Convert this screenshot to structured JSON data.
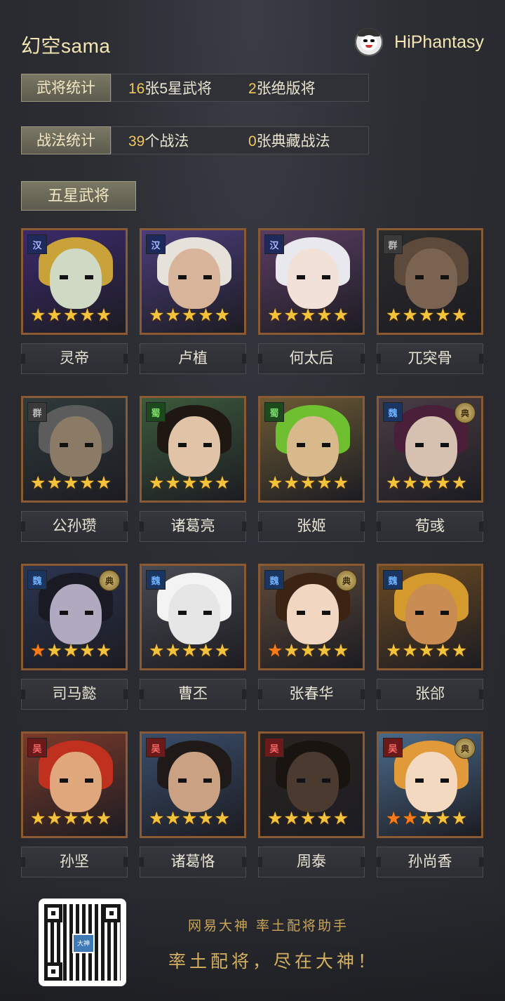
{
  "header": {
    "player_name": "幻空sama",
    "brand_name": "HiPhantasy",
    "brand_icon": "mascot-avatar-icon"
  },
  "hero_stats": {
    "tag": "武将统计",
    "five_star_count": "16",
    "five_star_suffix": "张5星武将",
    "limited_count": "2",
    "limited_suffix": "张绝版将"
  },
  "skill_stats": {
    "tag": "战法统计",
    "skill_count": "39",
    "skill_suffix": "个战法",
    "collection_count": "0",
    "collection_suffix": "张典藏战法"
  },
  "section_title": "五星武将",
  "colors": {
    "accent_gold": "#f0c85a",
    "star_yellow": "#f5c33b",
    "star_orange": "#ff7a1a",
    "frame_bronze": "#8b5a32"
  },
  "heroes": [
    {
      "name": "灵帝",
      "faction": "汉",
      "limited": false,
      "orange_stars": 0
    },
    {
      "name": "卢植",
      "faction": "汉",
      "limited": false,
      "orange_stars": 0
    },
    {
      "name": "何太后",
      "faction": "汉",
      "limited": false,
      "orange_stars": 0
    },
    {
      "name": "兀突骨",
      "faction": "群",
      "limited": false,
      "orange_stars": 0
    },
    {
      "name": "公孙瓒",
      "faction": "群",
      "limited": false,
      "orange_stars": 0
    },
    {
      "name": "诸葛亮",
      "faction": "蜀",
      "limited": false,
      "orange_stars": 0
    },
    {
      "name": "张姬",
      "faction": "蜀",
      "limited": false,
      "orange_stars": 0
    },
    {
      "name": "荀彧",
      "faction": "魏",
      "limited": true,
      "orange_stars": 0
    },
    {
      "name": "司马懿",
      "faction": "魏",
      "limited": true,
      "orange_stars": 1
    },
    {
      "name": "曹丕",
      "faction": "魏",
      "limited": false,
      "orange_stars": 0
    },
    {
      "name": "张春华",
      "faction": "魏",
      "limited": true,
      "orange_stars": 1
    },
    {
      "name": "张郃",
      "faction": "魏",
      "limited": false,
      "orange_stars": 0
    },
    {
      "name": "孙坚",
      "faction": "吴",
      "limited": false,
      "orange_stars": 0
    },
    {
      "name": "诸葛恪",
      "faction": "吴",
      "limited": false,
      "orange_stars": 0
    },
    {
      "name": "周泰",
      "faction": "吴",
      "limited": false,
      "orange_stars": 0
    },
    {
      "name": "孙尚香",
      "faction": "吴",
      "limited": true,
      "orange_stars": 2
    }
  ],
  "hero_star_count": 5,
  "limited_badge_text": "典",
  "footer": {
    "qr_center_text": "大神",
    "slogan_line1": "网易大神 率土配将助手",
    "slogan_line2": "率土配将，尽在大神！"
  }
}
